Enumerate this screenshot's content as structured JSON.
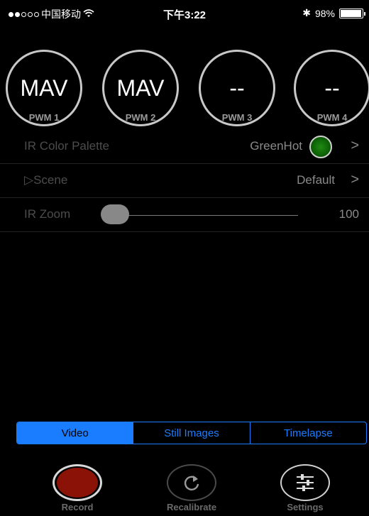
{
  "status_bar": {
    "carrier": "中国移动",
    "time": "下午3:22",
    "battery_percent_text": "98%",
    "battery_level": 0.98,
    "signal_bars_filled": 2,
    "signal_bars_total": 5
  },
  "pwm": [
    {
      "value": "MAV",
      "label": "PWM 1"
    },
    {
      "value": "MAV",
      "label": "PWM 2"
    },
    {
      "value": "--",
      "label": "PWM 3"
    },
    {
      "value": "--",
      "label": "PWM 4"
    }
  ],
  "settings": {
    "palette": {
      "label": "IR Color Palette",
      "value": "GreenHot",
      "swatch_color": "#1f8a12"
    },
    "scene": {
      "label": "▷Scene",
      "value": "Default"
    },
    "zoom": {
      "label": "IR Zoom",
      "value": "100",
      "slider_fraction": 0.0
    }
  },
  "modes": {
    "video": "Video",
    "still": "Still Images",
    "timelapse": "Timelapse",
    "selected": "Video"
  },
  "toolbar": {
    "record": "Record",
    "recalibrate": "Recalibrate",
    "settings": "Settings"
  },
  "colors": {
    "accent": "#1a7cff",
    "record_red": "#8a1206",
    "background": "#000000"
  }
}
